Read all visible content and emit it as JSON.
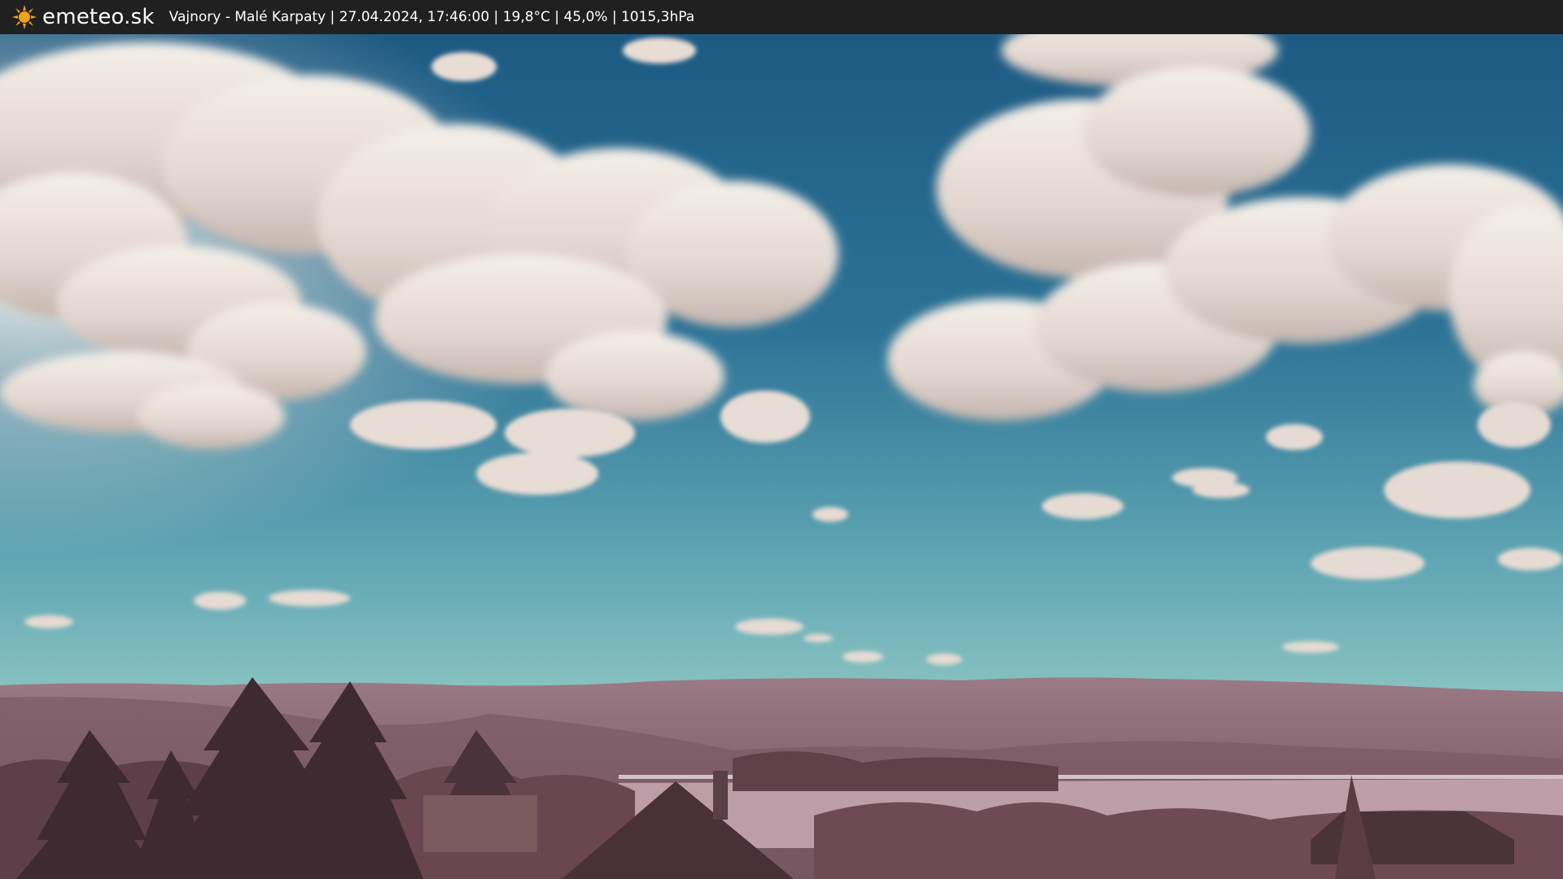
{
  "header": {
    "brand": "emeteo.sk",
    "info": "Vajnory - Malé Karpaty | 27.04.2024, 17:46:00 | 19,8°C | 45,0% | 1015,3hPa",
    "logo_icon": "sun-icon"
  },
  "colors": {
    "bar": "#202020",
    "sky_top": "#1f5f86",
    "sky_horizon": "#8fc6c4",
    "cloud": "#efe8e2",
    "hills": "#8e6b78",
    "foliage": "#5a3b44",
    "sun": "#f3a21b"
  }
}
